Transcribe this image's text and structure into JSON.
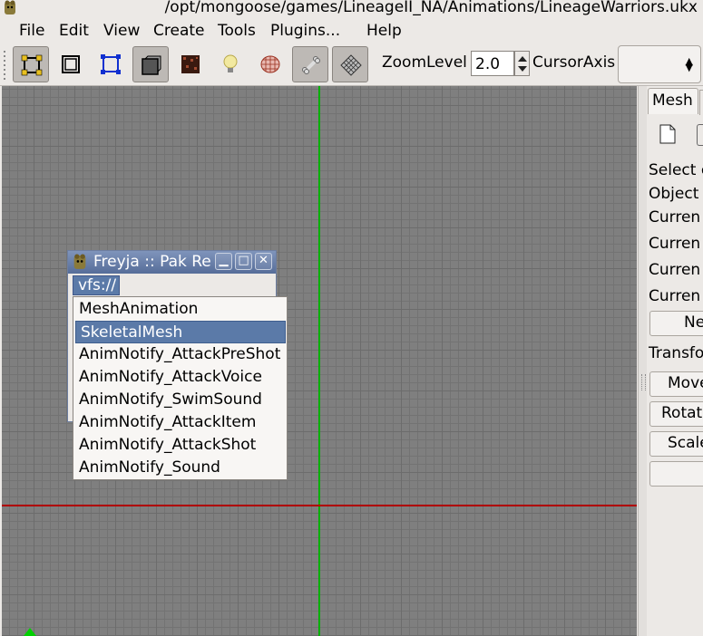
{
  "window": {
    "title": "/opt/mongoose/games/LineageII_NA/Animations/LineageWarriors.ukx"
  },
  "menu": [
    {
      "label": "File"
    },
    {
      "label": "Edit"
    },
    {
      "label": "View"
    },
    {
      "label": "Create"
    },
    {
      "label": "Tools"
    },
    {
      "label": "Plugins..."
    },
    {
      "label": "Help"
    }
  ],
  "toolbar": {
    "zoom_label": "ZoomLevel",
    "zoom_value": "2.0",
    "cursor_axis_label": "CursorAxis",
    "cursor_axis_value": ""
  },
  "right_panel": {
    "tab_label": "Mesh",
    "labels": [
      "Select e",
      "Object",
      "Curren",
      "Curren",
      "Curren",
      "Curren"
    ],
    "new_button": "Ne",
    "transform_label": "Transfo",
    "buttons": [
      "Move",
      "Rotat",
      "Scale",
      ""
    ]
  },
  "dialog": {
    "title": "Freyja :: Pak Re",
    "path_button": "vfs://",
    "minimize_glyph": "▁",
    "maximize_glyph": "□",
    "close_glyph": "✕"
  },
  "popup_list": {
    "items": [
      {
        "label": "MeshAnimation",
        "selected": false
      },
      {
        "label": "SkeletalMesh",
        "selected": true
      },
      {
        "label": "AnimNotify_AttackPreShot",
        "selected": false
      },
      {
        "label": "AnimNotify_AttackVoice",
        "selected": false
      },
      {
        "label": "AnimNotify_SwimSound",
        "selected": false
      },
      {
        "label": "AnimNotify_AttackItem",
        "selected": false
      },
      {
        "label": "AnimNotify_AttackShot",
        "selected": false
      },
      {
        "label": "AnimNotify_Sound",
        "selected": false
      }
    ]
  },
  "colors": {
    "viewport_bg": "#7f7f7f",
    "axis_y": "#00b000",
    "axis_x": "#b00000",
    "selection": "#5b7aa8"
  }
}
